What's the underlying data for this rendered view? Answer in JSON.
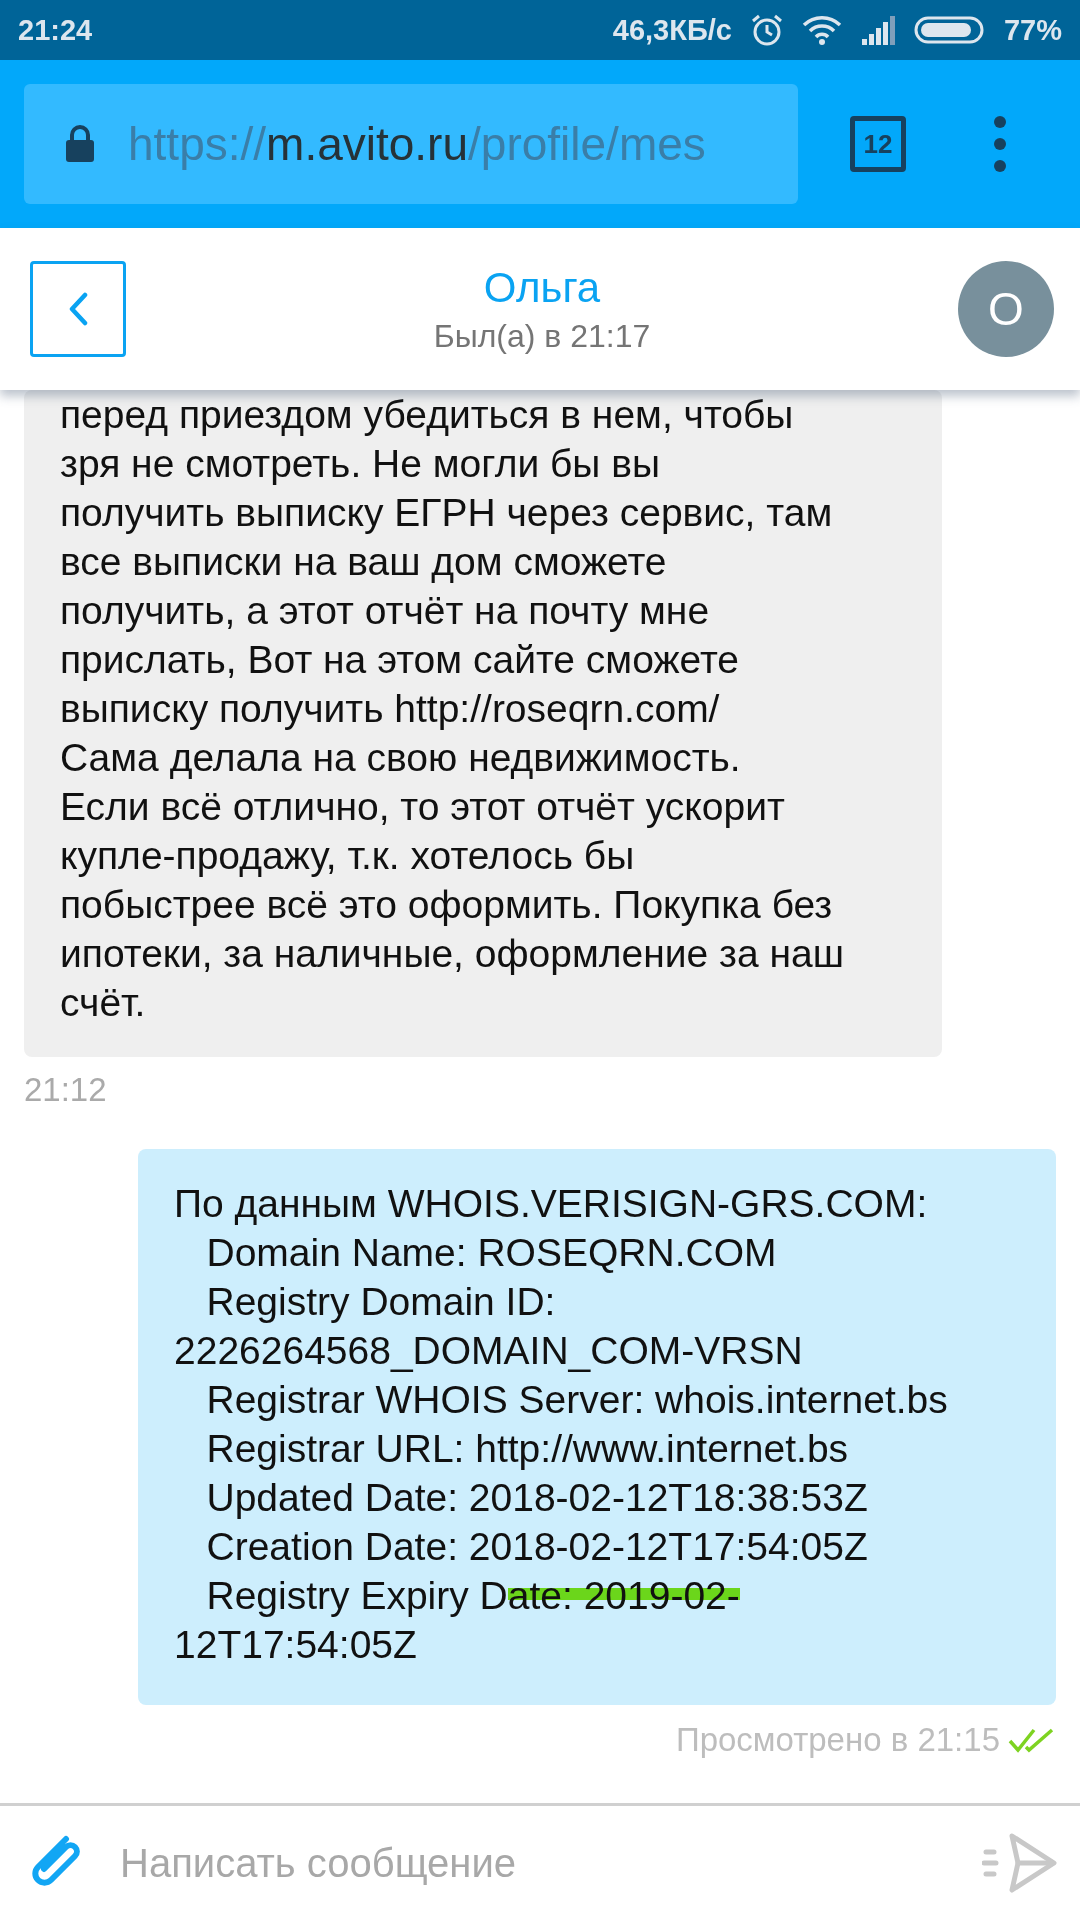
{
  "status_bar": {
    "time": "21:24",
    "speed": "46,3КБ/с",
    "battery": "77%"
  },
  "browser": {
    "url": {
      "scheme": "https://",
      "host": "m.avito.ru",
      "path": "/profile/mes"
    },
    "tab_count": "12"
  },
  "chat_header": {
    "name": "Ольга",
    "last_seen": "Был(а) в 21:17",
    "avatar_letter": "О"
  },
  "messages": [
    {
      "kind": "incoming",
      "text": "перед приездом убедиться в нем, чтобы\nзря не смотреть. Не могли бы вы\nполучить выписку ЕГРН через сервис, там\nвсе выписки на ваш дом сможете\nполучить, а этот отчёт на почту мне\nприслать, Вот на этом сайте сможете\nвыписку получить http://roseqrn.com/\nСама делала на свою недвижимость.\nЕсли всё отлично, то этот отчёт ускорит\nкупле-продажу, т.к. хотелось бы\nпобыстрее всё это оформить. Покупка без\nипотеки, за наличные, оформление за наш\nсчёт.",
      "time": "21:12"
    },
    {
      "kind": "outgoing",
      "parts": [
        {
          "text": "По данным WHOIS.VERISIGN-GRS.COM:\n   Domain Name: ROSEQRN.COM\n   Registry Domain ID:\n2226264568_DOMAIN_COM-VRSN\n   Registrar WHOIS Server: whois.internet.bs\n   Registrar URL: http://www.internet.bs\n   Updated Date: 2018-02-12T18:38:53Z\n   Creation Date: 2018-02-12T17:54:05Z\n   Registry Expiry D",
          "struck": false
        },
        {
          "text": "ate: 2019-02-",
          "struck": true
        },
        {
          "text": "\n12T17:54:05Z",
          "struck": false
        }
      ],
      "status": "Просмотрено в 21:15",
      "read": true
    }
  ],
  "composer": {
    "placeholder": "Написать сообщение"
  }
}
